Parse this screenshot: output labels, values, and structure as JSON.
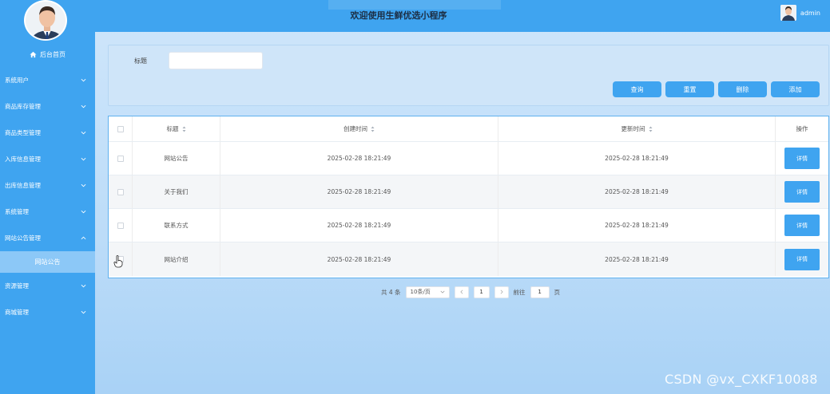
{
  "header": {
    "title": "欢迎使用生鲜优选小程序",
    "username": "admin"
  },
  "sidebar": {
    "home_label": "后台首页",
    "items": [
      {
        "label": "系统用户",
        "expanded": false
      },
      {
        "label": "商品库存管理",
        "expanded": false
      },
      {
        "label": "商品类型管理",
        "expanded": false
      },
      {
        "label": "入库信息管理",
        "expanded": false
      },
      {
        "label": "出库信息管理",
        "expanded": false
      },
      {
        "label": "系统管理",
        "expanded": false
      },
      {
        "label": "网站公告管理",
        "expanded": true
      }
    ],
    "sub_item": "网站公告",
    "items_after": [
      {
        "label": "资源管理"
      },
      {
        "label": "商城管理"
      }
    ]
  },
  "search": {
    "title_label": "标题",
    "title_value": "",
    "buttons": {
      "query": "查询",
      "reset": "重置",
      "delete": "删除",
      "add": "添加"
    }
  },
  "table": {
    "headers": {
      "title": "标题",
      "created": "创建时间",
      "updated": "更新时间",
      "op": "操作"
    },
    "rows": [
      {
        "title": "网站公告",
        "created": "2025-02-28 18:21:49",
        "updated": "2025-02-28 18:21:49",
        "action": "详情"
      },
      {
        "title": "关于我们",
        "created": "2025-02-28 18:21:49",
        "updated": "2025-02-28 18:21:49",
        "action": "详情"
      },
      {
        "title": "联系方式",
        "created": "2025-02-28 18:21:49",
        "updated": "2025-02-28 18:21:49",
        "action": "详情"
      },
      {
        "title": "网站介绍",
        "created": "2025-02-28 18:21:49",
        "updated": "2025-02-28 18:21:49",
        "action": "详情"
      }
    ]
  },
  "pagination": {
    "total": "共 4 条",
    "page_size": "10条/页",
    "current_page": "1",
    "goto_label": "前往",
    "goto_value": "1",
    "page_suffix": "页"
  },
  "watermark": "CSDN @vx_CXKF10088",
  "colors": {
    "primary": "#3fa4f0",
    "submenu": "#8cc8f7"
  }
}
